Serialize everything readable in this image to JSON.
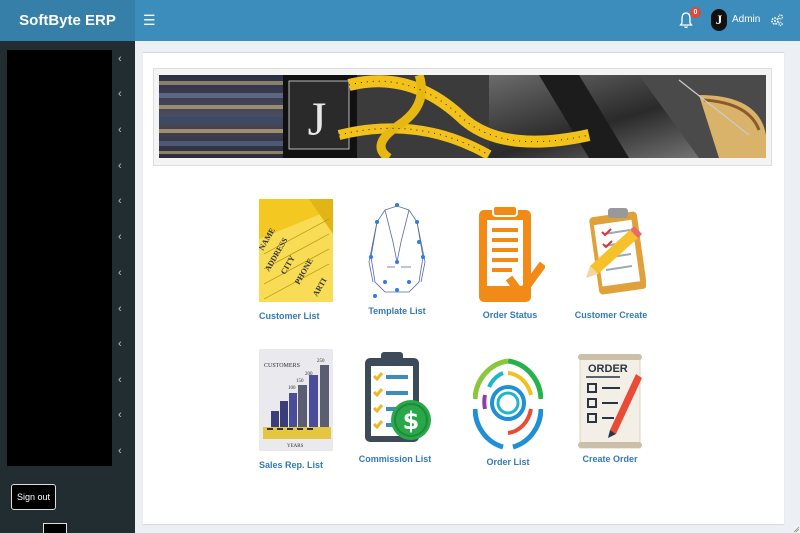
{
  "app": {
    "brand": "SoftByte ERP"
  },
  "header": {
    "notification_count": "0",
    "avatar_letter": "J",
    "user_name": "Admin"
  },
  "banner": {
    "logo_letter": "J"
  },
  "sidebar": {
    "sign_out_label": "Sign out"
  },
  "tiles": [
    {
      "label": "Customer List"
    },
    {
      "label": "Template List"
    },
    {
      "label": "Order Status"
    },
    {
      "label": "Customer Create"
    },
    {
      "label": "Sales Rep. List"
    },
    {
      "label": "Commission List"
    },
    {
      "label": "Order List"
    },
    {
      "label": "Create Order"
    }
  ],
  "customer_card_words": [
    "NAME",
    "ADDRESS",
    "CITY",
    "PHONE",
    "ARTI"
  ],
  "sales_chart": {
    "title": "CUSTOMERS",
    "xlabel": "YEARS",
    "tick_labels": [
      "100",
      "150",
      "200",
      "250"
    ]
  },
  "order_doc_title": "ORDER",
  "colors": {
    "brand": "#367fa9",
    "topbar": "#3c8dbc",
    "sidebar": "#222d32",
    "link": "#337ab7",
    "badge": "#dd4b39"
  }
}
